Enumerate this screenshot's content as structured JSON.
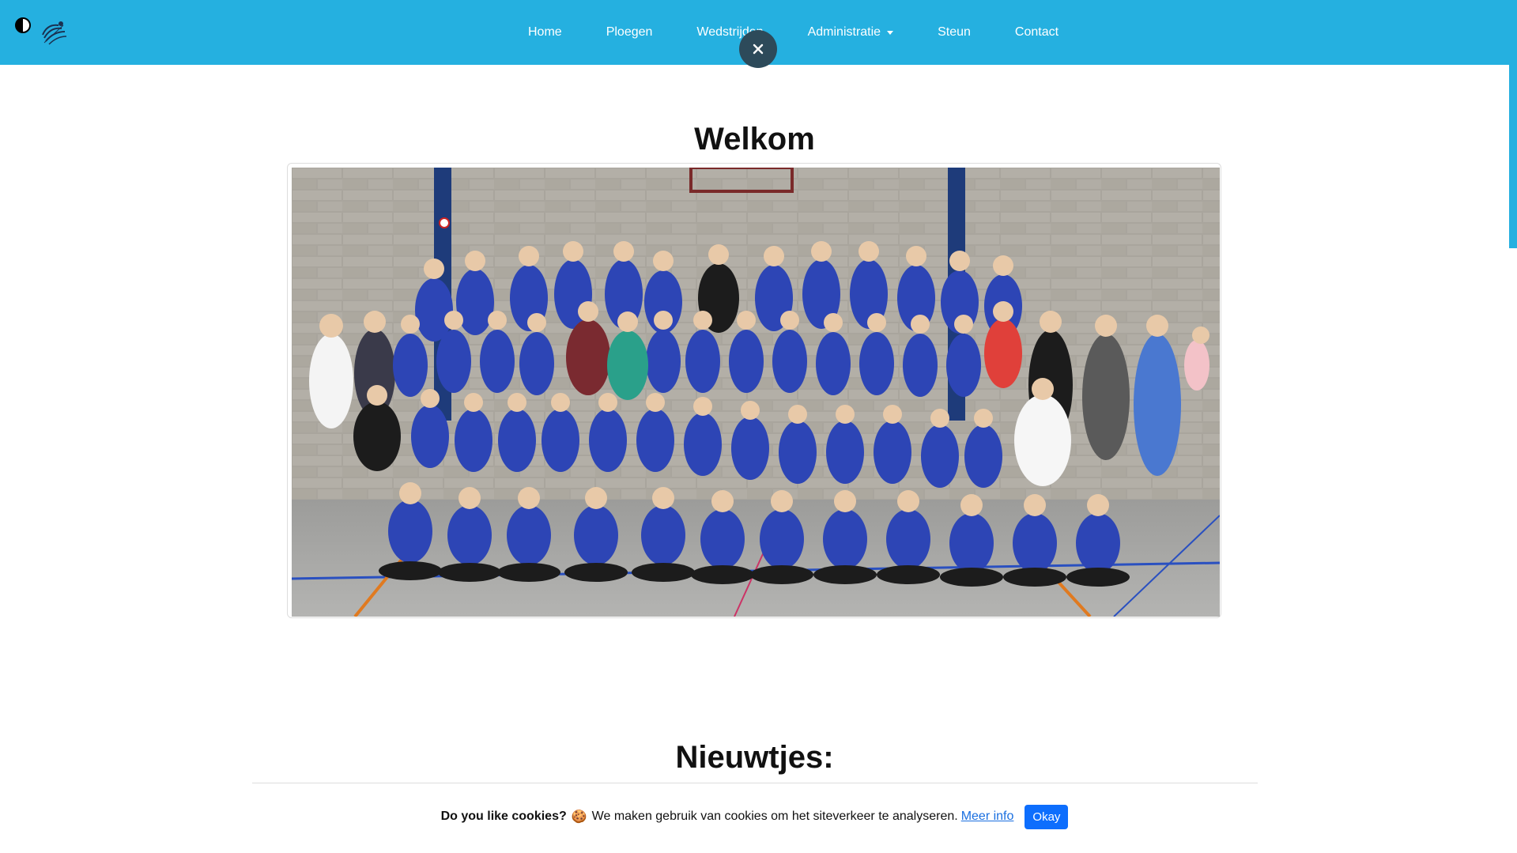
{
  "header": {
    "contrast_icon": "contrast-half-circle-icon",
    "logo_icon": "volleyball-club-logo",
    "nav": [
      {
        "label": "Home"
      },
      {
        "label": "Ploegen"
      },
      {
        "label": "Wedstrijden"
      },
      {
        "label": "Administratie",
        "has_dropdown": true
      },
      {
        "label": "Steun"
      },
      {
        "label": "Contact"
      }
    ],
    "close_icon": "close-icon",
    "colors": {
      "navbar": "#25b0e0",
      "close_button": "#2d4a5a",
      "nav_text": "#ffffff"
    }
  },
  "main": {
    "title": "Welkom",
    "photo": {
      "subject": "team-photo"
    },
    "news_title": "Nieuwtjes:"
  },
  "cookie_bar": {
    "title": "Do you like cookies?",
    "emoji": "🍪",
    "text": "We maken gebruik van cookies om het siteverkeer te analyseren.",
    "link": "Meer info",
    "button": "Okay",
    "colors": {
      "button": "#0d6efd",
      "link": "#1a6fe0"
    }
  }
}
